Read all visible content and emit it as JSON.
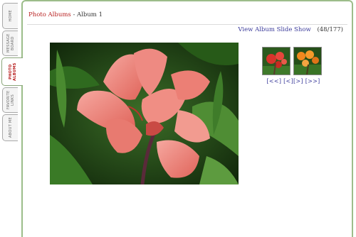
{
  "sidebar": {
    "tabs": [
      {
        "label": "Home"
      },
      {
        "label": "Message Board"
      },
      {
        "label": "Photo Albums"
      },
      {
        "label": "Favorite Links"
      },
      {
        "label": "About Me"
      }
    ]
  },
  "breadcrumb": {
    "root": "Photo Albums",
    "separator": " - ",
    "current": "Album 1"
  },
  "actions": {
    "view_album": "View Album",
    "slide_show": "Slide Show",
    "counter": "(48/177)"
  },
  "pager": {
    "first": "[<<]",
    "prev": "[<]",
    "next": "[>]",
    "last": "[>>]"
  },
  "colors": {
    "frame": "#9cbd8a",
    "link_red": "#b82020",
    "link_blue": "#3a3a9a"
  },
  "icons": {
    "main_photo": "pink-canna-flower-photo",
    "thumb_prev": "red-flower-thumbnail",
    "thumb_next": "orange-flower-thumbnail"
  }
}
